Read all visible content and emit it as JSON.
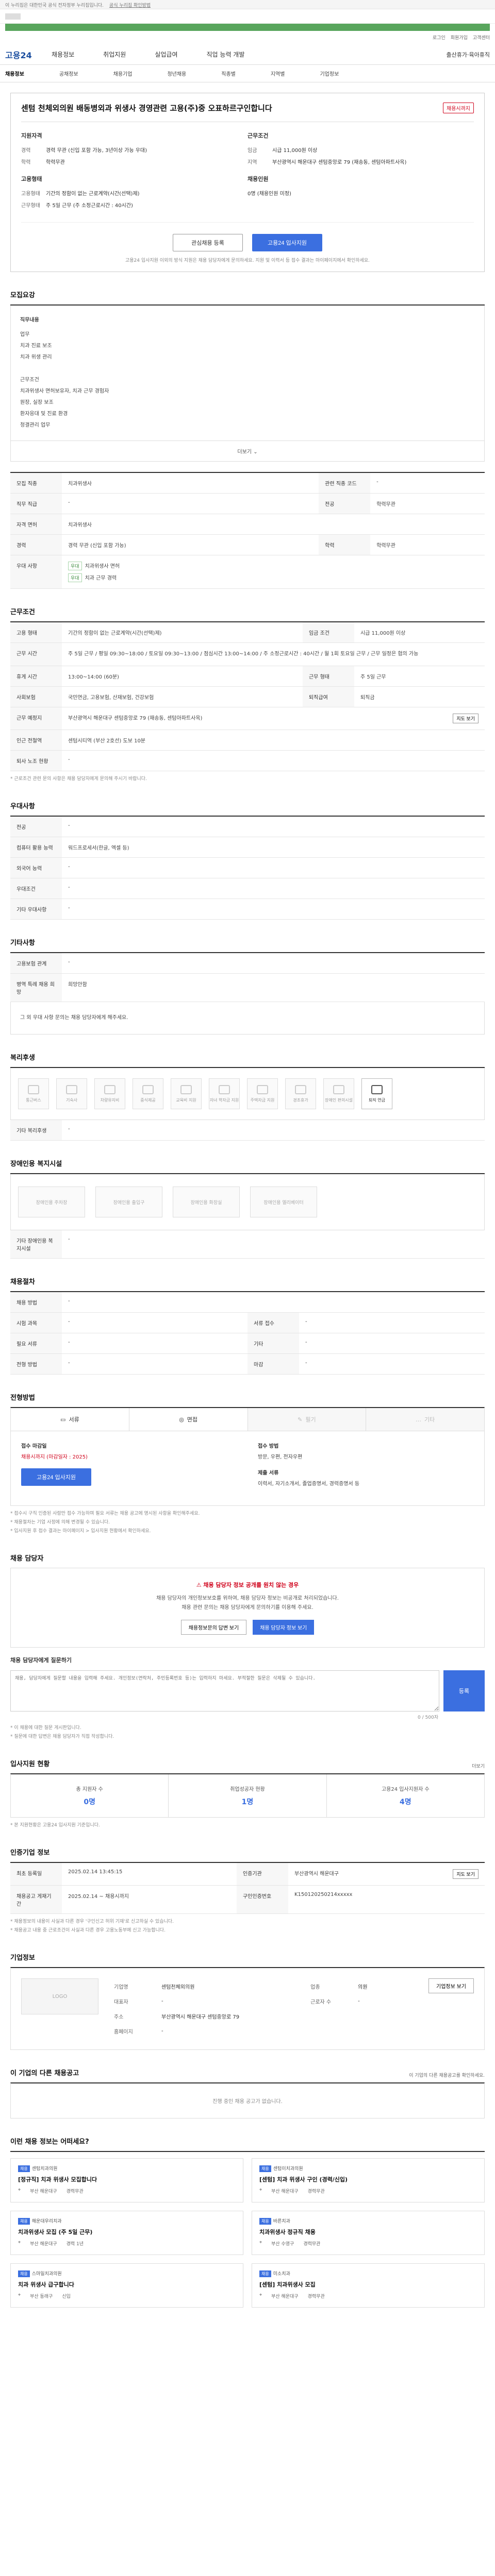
{
  "gov": {
    "notice": "이 누리집은 대한민국 공식 전자정부 누리집입니다.",
    "link": "공식 누리집 확인방법"
  },
  "util": {
    "login": "로그인",
    "join": "회원가입",
    "center": "고객센터"
  },
  "header": {
    "logo": "고용24",
    "nav": [
      "채용정보",
      "취업지원",
      "실업급여",
      "직업 능력 개발"
    ],
    "right": "출산휴가·육아휴직"
  },
  "subnav": [
    "채용정보",
    "공채정보",
    "채용기업",
    "청년채용",
    "직종별",
    "지역별",
    "기업정보"
  ],
  "job": {
    "title": "센텀 천체외의원 배동병외과 위생사 경영관련 고용(주)중 오표하르구인합니다",
    "badge": "채용시까지",
    "left_title": "지원자격",
    "left": [
      {
        "k": "경력",
        "v": "경력 무관 (신입 포함 가능, 3년이상 가능 우대)"
      },
      {
        "k": "학력",
        "v": "학력무관"
      }
    ],
    "left2_title": "고용형태",
    "left2": [
      {
        "k": "고용형태",
        "v": "기간의 정함이 없는 근로계약(시간(선택)제)"
      },
      {
        "k": "근무형태",
        "v": "주 5일 근무 (주 소정근로시간 : 40시간)"
      }
    ],
    "right_title": "근무조건",
    "right": [
      {
        "k": "임금",
        "v": "시급 11,000원 이상"
      },
      {
        "k": "지역",
        "v": "부산광역시 해운대구 센텀중앙로 79 (재송동, 센텀아파트사옥)"
      }
    ],
    "right2_title": "채용인원",
    "right2": [
      {
        "k": "",
        "v": "0명 (채용인원 미정)"
      }
    ],
    "btn_scrap": "관심채용 등록",
    "btn_apply": "고용24 입사지원",
    "head_note": "고용24 입사지원 이외의 방식 지원은 채용 담당자에게 문의하세요. 지원 및 이력서 등 접수 결과는 마이페이지에서 확인하세요."
  },
  "recruit": {
    "title": "모집요강",
    "duties_title": "직무내용",
    "duties": [
      "업무",
      "치과 진료 보조",
      "치과 위생 관리",
      "",
      "근무조건",
      "치과위생사 면허보유자, 치과 근무 경험자",
      "원장, 실장 보조",
      "환자응대 및 진료 환경",
      "청결관리 업무"
    ],
    "more": "더보기",
    "rows": [
      {
        "k": "모집 직종",
        "v": "치과위생사",
        "k2": "관련 직종 코드",
        "v2": "-"
      },
      {
        "k": "직무 직급",
        "v": "-",
        "k2": "전공",
        "v2": "학력무관"
      },
      {
        "k": "자격 면허",
        "v": "치과위생사",
        "k2": "",
        "v2": ""
      },
      {
        "k": "경력",
        "v": "경력 무관 (신입 포함 가능)",
        "k2": "학력",
        "v2": "학력무관"
      }
    ],
    "pref_label": "우대 사항",
    "pref": [
      "치과위생사 면허",
      "치과 근무 경력"
    ]
  },
  "conditions": {
    "title": "근무조건",
    "rows": [
      {
        "k": "고용 형태",
        "v": "기간의 정함이 없는 근로계약(시간(선택)제)",
        "k2": "임금 조건",
        "v2": "시급 11,000원 이상"
      },
      {
        "k": "근무 시간",
        "v": "주 5일 근무 / 평일 09:30~18:00 / 토요일 09:30~13:00 / 점심시간 13:00~14:00 / 주 소정근로시간 : 40시간 / 월 1회 토요일 근무 / 근무 일정은 협의 가능"
      },
      {
        "k": "휴게 시간",
        "v": "13:00~14:00 (60분)",
        "k2": "근무 형태",
        "v2": "주 5일 근무"
      },
      {
        "k": "사회보험",
        "v": "국민연금, 고용보험, 산재보험, 건강보험",
        "k2": "퇴직급여",
        "v2": "퇴직금"
      },
      {
        "k": "근무 예정지",
        "v": "부산광역시 해운대구 센텀중앙로 79 (재송동, 센텀아파트사옥)",
        "k2": "",
        "v2": ""
      },
      {
        "k": "인근 전철역",
        "v": "센텀시티역 (부산 2호선) 도보 10분",
        "k2": "",
        "v2": ""
      },
      {
        "k": "퇴사 노조 현황",
        "v": "-",
        "k2": "",
        "v2": ""
      }
    ],
    "map_btn": "지도 보기",
    "note": "* 근로조건 관련 문의 사항은 채용 담당자에게 문의해 주시기 바랍니다."
  },
  "etc_conditions": {
    "title": "우대사항",
    "rows": [
      {
        "k": "전공",
        "v": "-"
      },
      {
        "k": "컴퓨터 활용 능력",
        "v": "워드프로세서(한글, 엑셀 등)"
      },
      {
        "k": "외국어 능력",
        "v": "-"
      },
      {
        "k": "우대조건",
        "v": "-"
      },
      {
        "k": "기타 우대사항",
        "v": "-"
      }
    ]
  },
  "other": {
    "title": "기타사항",
    "rows": [
      {
        "k": "고용보험 관계",
        "v": "-"
      },
      {
        "k": "병역 특례 채용 희망",
        "v": "희망안함"
      }
    ],
    "apply_info": "그 외 우대 사항 문의는 채용 담당자에게 해주세요."
  },
  "welfare": {
    "title": "복리후생",
    "items": [
      {
        "label": "통근버스",
        "active": false
      },
      {
        "label": "기숙사",
        "active": false
      },
      {
        "label": "차량유지비",
        "active": false
      },
      {
        "label": "중식제공",
        "active": false
      },
      {
        "label": "교육비 지원",
        "active": false
      },
      {
        "label": "자녀 학자금 지원",
        "active": false
      },
      {
        "label": "주택자금 지원",
        "active": false
      },
      {
        "label": "경조휴가",
        "active": false
      },
      {
        "label": "장애인 편의시설",
        "active": false
      },
      {
        "label": "퇴직 연금",
        "active": true
      }
    ],
    "other_label": "기타 복리후생",
    "other_value": "-"
  },
  "disability": {
    "title": "장애인용 복지시설",
    "items": [
      "장애인용 주차장",
      "장애인용 출입구",
      "장애인용 화장실",
      "장애인용 엘리베이터"
    ],
    "note_label": "기타 장애인용 복지시설",
    "note_value": "-"
  },
  "selection": {
    "title": "채용절차",
    "rows": [
      {
        "k": "채용 방법",
        "v": "-"
      },
      {
        "k": "시험 과목",
        "v": "-",
        "k2": "서류 접수",
        "v2": "-"
      },
      {
        "k": "필요 서류",
        "v": "-",
        "k2": "기타",
        "v2": "-"
      },
      {
        "k": "전형 방법",
        "v": "-",
        "k2": "마감",
        "v2": "-"
      }
    ]
  },
  "method": {
    "title": "전형방법",
    "cells": [
      {
        "label": "서류",
        "off": false
      },
      {
        "label": "면접",
        "off": false
      },
      {
        "label": "필기",
        "off": true
      },
      {
        "label": "기타",
        "off": true
      }
    ],
    "apply_col1": [
      {
        "lbl": "접수 마감일",
        "val": "채용시까지 (마감일자 : 2025)",
        "red": true
      },
      {
        "lbl": "",
        "val": ""
      }
    ],
    "apply_btn": "고용24 입사지원",
    "apply_col2": [
      {
        "lbl": "접수 방법",
        "val": "방문, 우편, 전자우편"
      },
      {
        "lbl": "제출 서류",
        "val": "이력서, 자기소개서, 졸업증명서, 경력증명서 등"
      }
    ],
    "notes": [
      "* 접수시 구직 인증된 사람만 접수 가능하며 필요 서류는 채용 공고에 명시된 사항을 확인해주세요.",
      "* 채용절차는 기업 사정에 의해 변경될 수 있습니다.",
      "* 입사지원 후 접수 결과는 마이페이지 > 입사지원 현황에서 확인하세요."
    ]
  },
  "manager": {
    "title": "채용 담당자",
    "warn": "채용 담당자 정보 공개를 원치 않는 경우",
    "p1": "채용 담당자의 개인정보보호를 위하여, 채용 담당자 정보는 비공개로 처리되었습니다.",
    "p2": "채용 관련 문의는 채용 담당자에게 문의하기를 이용해 주세요.",
    "btn1": "채용정보문의 답변 보기",
    "btn2": "채용 담당자 정보 보기",
    "qa_title": "채용 담당자에게 질문하기",
    "qa_placeholder": "채용, 담당자에게 질문할 내용을 입력해 주세요. 개인정보(연락처, 주민등록번호 등)는 입력하지 마세요. 부적절한 질문은 삭제될 수 있습니다.",
    "qa_count": "0 / 500자",
    "qa_submit": "등록",
    "qa_notes": [
      "* 이 채용에 대한 질문 게시판입니다.",
      "* 질문에 대한 답변은 채용 담당자가 직접 작성합니다."
    ]
  },
  "stats": {
    "title": "입사지원 현황",
    "more": "더보기",
    "items": [
      {
        "t": "총 지원자 수",
        "n": "0명"
      },
      {
        "t": "취업성공자 현황",
        "n": "1명"
      },
      {
        "t": "고용24 입사지원자 수",
        "n": "4명"
      }
    ],
    "note": "* 본 지원현황은 고용24 입사지원 기준입니다."
  },
  "info": {
    "title": "인증기업 정보",
    "rows": [
      {
        "k": "최초 등록일",
        "v": "2025.02.14 13:45:15",
        "k2": "인증기관",
        "v2": "부산광역시 해운대구"
      },
      {
        "k": "채용공고 게재기간",
        "v": "2025.02.14 ~ 채용시까지",
        "k2": "구인인증번호",
        "v2": "K150120250214xxxxx"
      }
    ],
    "btn": "지도 보기",
    "notes": [
      "* 채용정보의 내용이 사실과 다른 경우 '구인신고 허위 기재'로 신고하실 수 있습니다.",
      "* 채용공고 내용 중 근로조건이 사실과 다른 경우 고용노동부에 신고 가능합니다."
    ]
  },
  "company": {
    "title": "기업정보",
    "logo_text": "LOGO",
    "rows": [
      {
        "k": "기업명",
        "v": "센텀천체외의원",
        "k2": "업종",
        "v2": "의원"
      },
      {
        "k": "대표자",
        "v": "-",
        "k2": "근로자 수",
        "v2": "-"
      },
      {
        "k": "주소",
        "v": "부산광역시 해운대구 센텀중앙로 79",
        "k2": "",
        "v2": ""
      },
      {
        "k": "홈페이지",
        "v": "-",
        "k2": "",
        "v2": ""
      }
    ],
    "btn": "기업정보 보기"
  },
  "others": {
    "title": "이 기업의 다른 채용공고",
    "sub": "이 기업의 다른 채용공고를 확인하세요.",
    "empty": "진행 중인 채용 공고가 없습니다."
  },
  "recommend": {
    "title": "이런 채용 정보는 어떠세요?",
    "cards": [
      {
        "co": "센텀치과의원",
        "title": "[정규직] 치과 위생사 모집합니다",
        "loc": "부산 해운대구",
        "career": "경력무관"
      },
      {
        "co": "센텀이치과의원",
        "title": "[센텀] 치과 위생사 구인 (경력/신입)",
        "loc": "부산 해운대구",
        "career": "경력무관"
      },
      {
        "co": "해운대우리치과",
        "title": "치과위생사 모집 (주 5일 근무)",
        "loc": "부산 해운대구",
        "career": "경력 1년"
      },
      {
        "co": "바른치과",
        "title": "치과위생사 정규직 채용",
        "loc": "부산 수영구",
        "career": "경력무관"
      },
      {
        "co": "스마일치과의원",
        "title": "치과 위생사 급구합니다",
        "loc": "부산 동래구",
        "career": "신입"
      },
      {
        "co": "미소치과",
        "title": "[센텀] 치과위생사 모집",
        "loc": "부산 해운대구",
        "career": "경력무관"
      }
    ]
  }
}
